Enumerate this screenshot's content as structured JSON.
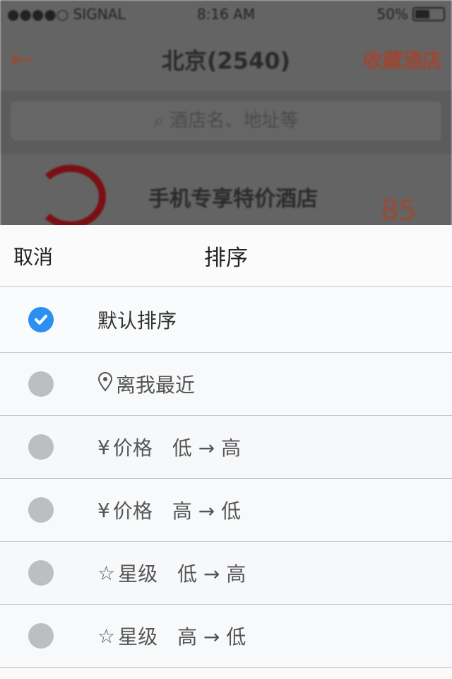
{
  "status_bar": {
    "signal": "●●●●○ SIGNAL",
    "time": "8:16 AM",
    "battery": "50%",
    "battery_level": 0.5
  },
  "background": {
    "nav_title": "北京(2540)",
    "favorite_label": "收藏酒店",
    "search_placeholder": "酒店名、地址等",
    "hotel_name": "手机专享特价酒店",
    "hotel_price": "85",
    "accent": "#e0552b"
  },
  "sheet": {
    "cancel_label": "取消",
    "title": "排序",
    "selected_color": "#2c8ff2",
    "options": [
      {
        "label": "默认排序",
        "icon": "",
        "selected": true
      },
      {
        "label": "离我最近",
        "icon": "location-pin",
        "selected": false
      },
      {
        "label": "价格　低 → 高",
        "icon": "¥",
        "selected": false
      },
      {
        "label": "价格　高 → 低",
        "icon": "¥",
        "selected": false
      },
      {
        "label": "星级　低 → 高",
        "icon": "☆",
        "selected": false
      },
      {
        "label": "星级　高 → 低",
        "icon": "☆",
        "selected": false
      }
    ]
  }
}
